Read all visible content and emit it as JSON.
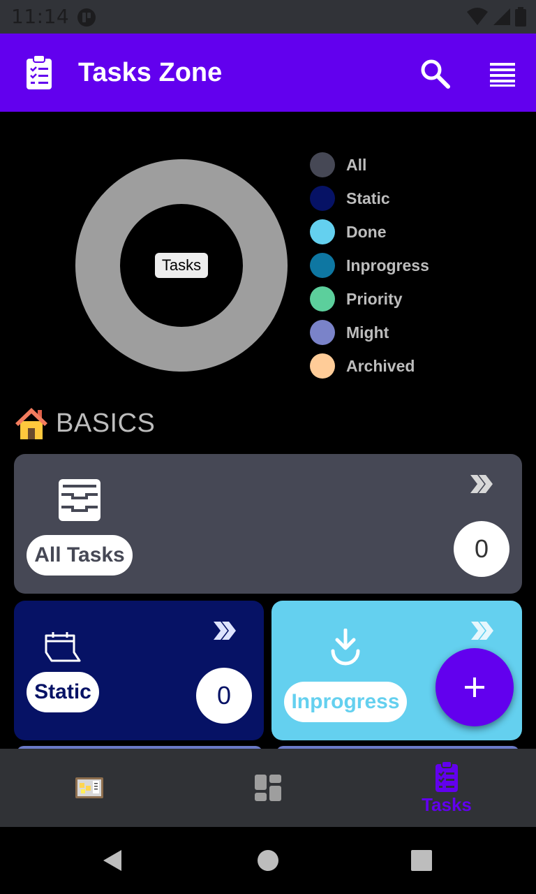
{
  "status_bar": {
    "time": "11:14"
  },
  "app_bar": {
    "title": "Tasks Zone",
    "color": "#6200ee"
  },
  "chart": {
    "center_label": "Tasks",
    "ring_color": "#9e9e9e",
    "legend": [
      {
        "label": "All",
        "color": "#464855"
      },
      {
        "label": "Static",
        "color": "#061265"
      },
      {
        "label": "Done",
        "color": "#64d0ef"
      },
      {
        "label": "Inprogress",
        "color": "#0e77a2"
      },
      {
        "label": "Priority",
        "color": "#5ccf9c"
      },
      {
        "label": "Might",
        "color": "#7a83c9"
      },
      {
        "label": "Archived",
        "color": "#ffcc98"
      }
    ]
  },
  "basics": {
    "title": "BASICS",
    "cards": {
      "all": {
        "label": "All Tasks",
        "count": "0",
        "color": "#464855",
        "label_color": "#464855"
      },
      "static": {
        "label": "Static",
        "count": "0",
        "color": "#061265",
        "label_color": "#061265"
      },
      "inprogress": {
        "label": "Inprogress",
        "color": "#64d0ef",
        "label_color": "#64d0ef"
      }
    }
  },
  "fab": {
    "icon": "plus-icon"
  },
  "bottom_nav": {
    "items": [
      {
        "icon": "notice-board-icon",
        "label": ""
      },
      {
        "icon": "dashboard-icon",
        "label": ""
      },
      {
        "icon": "clipboard-list-icon",
        "label": "Tasks",
        "active": true
      }
    ]
  }
}
